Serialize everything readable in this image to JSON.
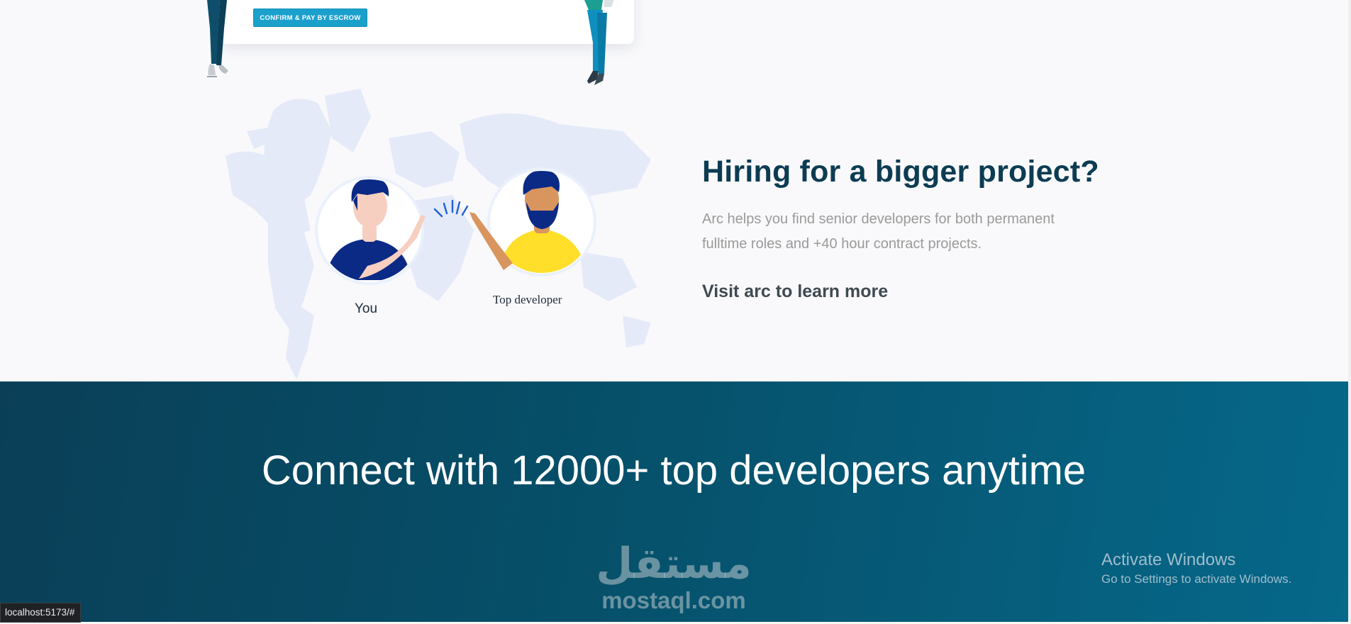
{
  "escrow": {
    "button_label": "CONFIRM & PAY BY ESCROW"
  },
  "hiring": {
    "title": "Hiring for a bigger project?",
    "description": "Arc helps you find senior developers for both permanent fulltime roles and +40 hour contract projects.",
    "link_label": "Visit arc to learn more",
    "you_label": "You",
    "developer_label": "Top developer"
  },
  "connect": {
    "title": "Connect with 12000+ top developers anytime"
  },
  "watermark": {
    "arabic": "مستقل",
    "latin": "mostaql.com"
  },
  "windows_activation": {
    "title": "Activate Windows",
    "subtitle": "Go to Settings to activate Windows."
  },
  "status_bar": {
    "url": "localhost:5173/#"
  },
  "colors": {
    "escrow_button": "#1ba0cc",
    "heading": "#0c3c52",
    "banner_start": "#0a3f57",
    "banner_end": "#06688a"
  }
}
